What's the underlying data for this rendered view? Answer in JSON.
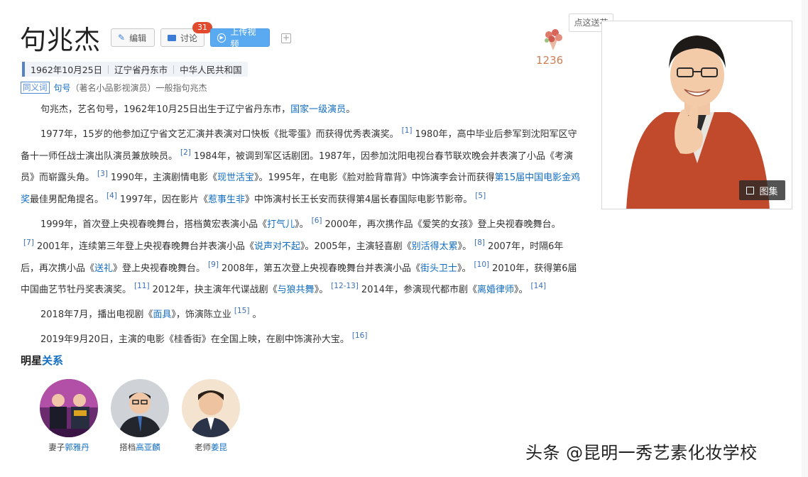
{
  "title": "句兆杰",
  "toolbar": {
    "edit_label": "编辑",
    "discuss_label": "讨论",
    "discuss_count": "31",
    "upload_label": "上传视频",
    "plus_label": "+"
  },
  "info": {
    "birth_date": "1962年10月25日",
    "birth_place": "辽宁省丹东市",
    "country": "中华人民共和国"
  },
  "synonym": {
    "tag": "同义词",
    "term": "句号",
    "detail": "（著名小品影视演员）一般指句兆杰"
  },
  "paragraphs": [
    {
      "p1_a": "句兆杰，艺名句号，1962年10月25日出生于辽宁省丹东市，",
      "p1_link": "国家一级演员",
      "p1_b": "。"
    }
  ],
  "para2": {
    "a": "1977年，15岁的他参加辽宁省文艺汇演并表演对口快板《批零蛋》而获得优秀表演奖。",
    "ref1": "[1]",
    "b": "1980年，高中毕业后参军到沈阳军区守备十一师任战士演出队演员兼放映员。",
    "ref2": "[2]",
    "c": "1984年，被调到军区话剧团。1987年，因参加沈阳电视台春节联欢晚会并表演了小品《考演员》而崭露头角。",
    "ref3": "[3]",
    "d": "1990年，主演剧情电影《",
    "link1": "现世活宝",
    "e": "》。1995年，在电影《脸对脸背靠背》中饰演李会计而获得",
    "link2": "第15届中国电影金鸡奖",
    "f": "最佳男配角提名。",
    "ref4": "[4]",
    "g": "1997年，因在影片《",
    "link3": "惹事生非",
    "h": "》中饰演村长王长安而获得第4届长春国际电影节影帝。",
    "ref5": "[5]"
  },
  "para3": {
    "a": "1999年，首次登上央视春晚舞台，搭档黄宏表演小品《",
    "link1": "打气儿",
    "b": "》。",
    "ref6": "[6]",
    "c": "2000年，再次携作品《爱笑的女孩》登上央视春晚舞台。",
    "ref7": "[7]",
    "d": "2001年，连续第三年登上央视春晚舞台并表演小品《",
    "link2": "说声对不起",
    "e": "》。2005年，主演轻喜剧《",
    "link3": "别活得太累",
    "f": "》。",
    "ref8": "[8]",
    "g": "2007年，时隔6年后，再次携小品《",
    "link4": "送礼",
    "h": "》登上央视春晚舞台。",
    "ref9": "[9]",
    "i": "2008年，第五次登上央视春晚舞台并表演小品《",
    "link5": "街头卫士",
    "j": "》。",
    "ref10": "[10]",
    "k": "2010年，获得第6届中国曲艺节牡丹奖表演奖。",
    "ref11": "[11]",
    "l": "2012年，抉主演年代谍战剧《",
    "link6": "与狼共舞",
    "m": "》。",
    "ref12": "[12-13]",
    "n": "2014年，参演现代都市剧《",
    "link7": "离婚律师",
    "o": "》。",
    "ref14": "[14]"
  },
  "para4": {
    "a": "2018年7月，播出电视剧《",
    "link": "面具",
    "b": "》，饰演陈立业",
    "ref": "[15]",
    "c": "。"
  },
  "para5": {
    "a": "2019年9月20日，主演的电影《桂香街》在全国上映，在剧中饰演孙大宝。",
    "ref": "[16]"
  },
  "relations": {
    "heading_a": "明星",
    "heading_b": "关系",
    "items": [
      {
        "role": "妻子",
        "name": "郭雅丹"
      },
      {
        "role": "搭档",
        "name": "高亚麟"
      },
      {
        "role": "老师",
        "name": "姜昆"
      }
    ]
  },
  "flowers": {
    "count": "1236",
    "gift_label": "点这送花"
  },
  "photo": {
    "gallery_label": "图集"
  },
  "watermark": "头条 @昆明一秀艺素化妆学校",
  "colors": {
    "link": "#136ec2",
    "upload_button": "#5aaaf2",
    "badge": "#e24a2d",
    "info_bar_accent": "#5584c4"
  }
}
